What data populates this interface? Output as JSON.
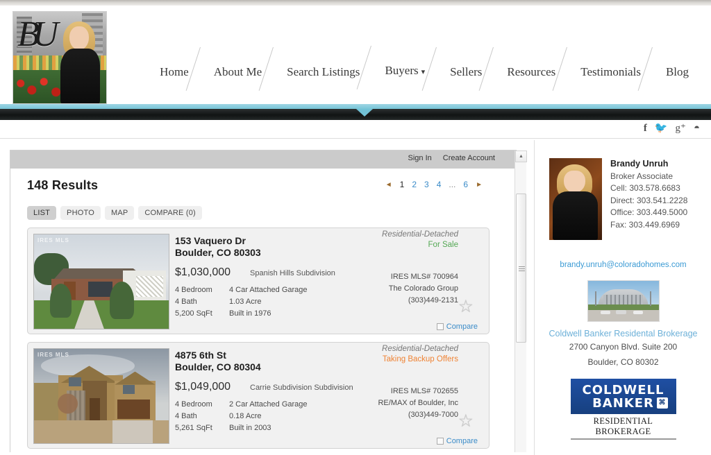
{
  "site": {
    "logo_monogram": "BU",
    "nav": [
      {
        "label": "Home",
        "has_caret": false
      },
      {
        "label": "About Me",
        "has_caret": false
      },
      {
        "label": "Search Listings",
        "has_caret": false
      },
      {
        "label": "Buyers",
        "has_caret": true
      },
      {
        "label": "Sellers",
        "has_caret": false
      },
      {
        "label": "Resources",
        "has_caret": false
      },
      {
        "label": "Testimonials",
        "has_caret": false
      },
      {
        "label": "Blog",
        "has_caret": false
      }
    ],
    "social": [
      {
        "name": "facebook-icon",
        "glyph": "f"
      },
      {
        "name": "twitter-icon",
        "glyph": "ᵗ"
      },
      {
        "name": "googleplus-icon",
        "glyph": "g⁺"
      },
      {
        "name": "rss-icon",
        "glyph": "◔"
      }
    ],
    "accent_teal": "#72c2d6",
    "link_blue": "#3a8bc8"
  },
  "account": {
    "sign_in": "Sign In",
    "create_account": "Create Account"
  },
  "results": {
    "count_label": "148 Results",
    "pagination": {
      "prev": "◄",
      "next": "►",
      "pages": [
        "1",
        "2",
        "3",
        "4",
        "...",
        "6"
      ],
      "current": "1"
    },
    "tabs": [
      {
        "label": "LIST",
        "active": true
      },
      {
        "label": "PHOTO",
        "active": false
      },
      {
        "label": "MAP",
        "active": false
      },
      {
        "label": "COMPARE (0)",
        "active": false
      }
    ],
    "compare_label": "Compare",
    "watermark": "IRES MLS"
  },
  "listings": [
    {
      "address": "153 Vaquero Dr",
      "city_state_zip": "Boulder, CO 80303",
      "property_type": "Residential-Detached",
      "status": "For Sale",
      "status_color": "#54a854",
      "price": "$1,030,000",
      "subdivision": "Spanish Hills Subdivision",
      "bedrooms": "4 Bedroom",
      "baths": "4 Bath",
      "sqft": "5,200 SqFt",
      "garage": "4 Car Attached Garage",
      "lot": "1.03 Acre",
      "year_built": "Built in 1976",
      "mls": "IRES MLS# 700964",
      "brokerage": "The Colorado Group",
      "phone": "(303)449-2131"
    },
    {
      "address": "4875 6th St",
      "city_state_zip": "Boulder, CO 80304",
      "property_type": "Residential-Detached",
      "status": "Taking Backup Offers",
      "status_color": "#ef8334",
      "price": "$1,049,000",
      "subdivision": "Carrie Subdivision Subdivision",
      "bedrooms": "4 Bedroom",
      "baths": "4 Bath",
      "sqft": "5,261 SqFt",
      "garage": "2 Car Attached Garage",
      "lot": "0.18 Acre",
      "year_built": "Built in 2003",
      "mls": "IRES MLS# 702655",
      "brokerage": "RE/MAX of Boulder, Inc",
      "phone": "(303)449-7000"
    }
  ],
  "agent": {
    "name": "Brandy Unruh",
    "title": "Broker Associate",
    "cell": "Cell: 303.578.6683",
    "direct": "Direct: 303.541.2228",
    "office": "Office: 303.449.5000",
    "fax": "Fax: 303.449.6969",
    "email": "brandy.unruh@coloradohomes.com"
  },
  "brokerage": {
    "name": "Coldwell Banker Residental Brokerage",
    "address_line1": "2700 Canyon Blvd. Suite 200",
    "address_line2": "Boulder, CO 80302",
    "logo_line1": "COLDWELL",
    "logo_line2": "BANKER",
    "logo_mark": "⌘",
    "logo_sub": "RESIDENTIAL BROKERAGE"
  }
}
